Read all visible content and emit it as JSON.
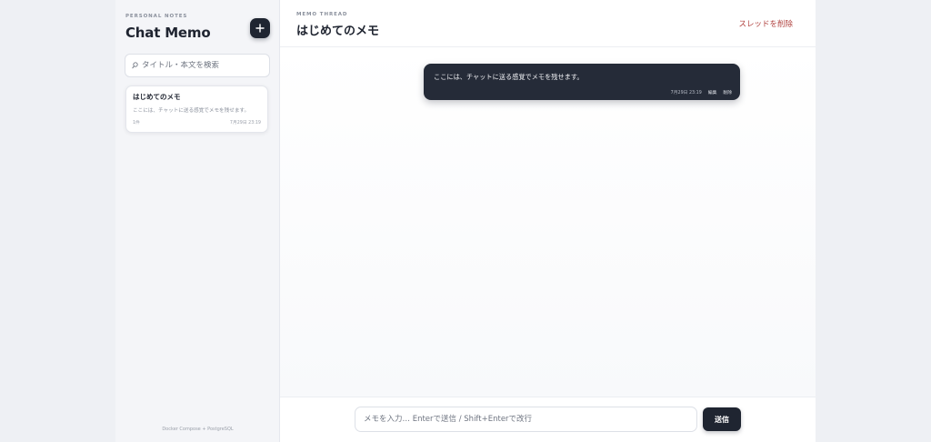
{
  "sidebar": {
    "eyebrow": "PERSONAL NOTES",
    "title": "Chat Memo",
    "add_icon": "plus-icon",
    "search": {
      "icon": "search-icon",
      "placeholder": "タイトル・本文を検索",
      "value": ""
    },
    "memos": [
      {
        "title": "はじめてのメモ",
        "preview": "ここには、チャットに送る感覚でメモを残せます。",
        "count": "1件",
        "time": "7月29日 23:19"
      }
    ],
    "footer": "Docker Compose + PostgreSQL"
  },
  "main": {
    "eyebrow": "MEMO THREAD",
    "title": "はじめてのメモ",
    "delete_thread_label": "スレッドを削除",
    "messages": [
      {
        "text": "ここには、チャットに送る感覚でメモを残せます。",
        "time": "7月29日 23:19",
        "edit_label": "編集",
        "delete_label": "削除"
      }
    ],
    "composer": {
      "placeholder": "メモを入力… Enterで送信 / Shift+Enterで改行",
      "value": "",
      "send_label": "送信"
    }
  },
  "colors": {
    "accent_dark": "#1f2531",
    "danger": "#b0413e",
    "bubble": "#252b38"
  }
}
